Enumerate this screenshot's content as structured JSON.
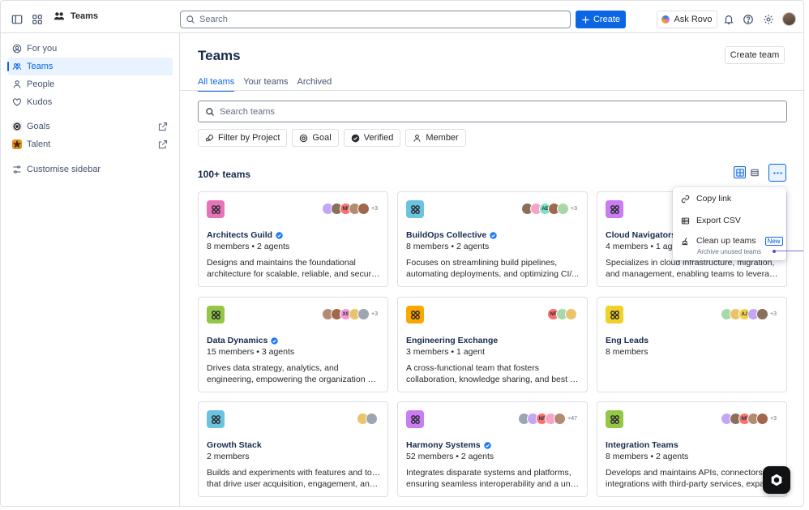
{
  "topnav": {
    "app_name": "Teams",
    "search_placeholder": "Search",
    "create_label": "Create",
    "ask_rovo_label": "Ask Rovo"
  },
  "sidebar": {
    "items": [
      {
        "label": "For you",
        "icon": "user-circle-icon"
      },
      {
        "label": "Teams",
        "icon": "teams-icon",
        "active": true
      },
      {
        "label": "People",
        "icon": "person-icon"
      },
      {
        "label": "Kudos",
        "icon": "heart-icon"
      }
    ],
    "apps": [
      {
        "label": "Goals",
        "icon": "goals-icon"
      },
      {
        "label": "Talent",
        "icon": "talent-icon"
      }
    ],
    "customise_label": "Customise sidebar"
  },
  "main": {
    "title": "Teams",
    "create_team_label": "Create team",
    "tabs": [
      "All teams",
      "Your teams",
      "Archived"
    ],
    "search_placeholder": "Search teams",
    "filters": [
      "Filter by Project",
      "Goal",
      "Verified",
      "Member"
    ],
    "count_label": "100+ teams"
  },
  "menu": {
    "items": [
      "Copy link",
      "Export CSV",
      "Clean up teams"
    ],
    "badge": "New",
    "subtext": "Archive unused teams"
  },
  "cards": [
    {
      "name": "Architects Guild",
      "verified": true,
      "meta": "8 members • 2 agents",
      "desc": [
        "Designs and maintains the foundational",
        "architecture for scalable, reliable, and secure..."
      ],
      "color": "#e774bb",
      "avatars": [
        "",
        "",
        "NF",
        "",
        ""
      ],
      "more": "+3"
    },
    {
      "name": "BuildOps Collective",
      "verified": true,
      "meta": "8 members • 2 agents",
      "desc": [
        "Focuses on streamlining build pipelines,",
        "automating deployments, and optimizing CI/..."
      ],
      "color": "#6cc3e0",
      "avatars": [
        "",
        "",
        "AE",
        "",
        ""
      ],
      "more": "+3"
    },
    {
      "name": "Cloud Navigators",
      "verified": true,
      "meta": "4 members • 1 agent",
      "desc": [
        "Specializes in cloud infrastructure, migration,",
        "and management, enabling teams to leverage..."
      ],
      "color": "#c97cf4",
      "avatars": [],
      "more": ""
    },
    {
      "name": "Data Dynamics",
      "verified": true,
      "meta": "15 members • 3 agents",
      "desc": [
        "Drives data strategy, analytics, and",
        "engineering, empowering the organization with..."
      ],
      "color": "#94c748",
      "avatars": [
        "",
        "",
        "XS",
        "",
        ""
      ],
      "more": "+3"
    },
    {
      "name": "Engineering Exchange",
      "verified": false,
      "meta": "3 members • 1 agent",
      "desc": [
        "A cross-functional team that fosters",
        "collaboration, knowledge sharing, and best p..."
      ],
      "color": "#fca700",
      "avatars": [
        "NF",
        "",
        ""
      ],
      "more": ""
    },
    {
      "name": "Eng Leads",
      "verified": false,
      "meta": "8 members",
      "desc": [],
      "color": "#eed12b",
      "avatars": [
        "",
        "",
        "AJ",
        "",
        ""
      ],
      "more": "+3"
    },
    {
      "name": "Growth Stack",
      "verified": false,
      "meta": "2 members",
      "desc": [
        "Builds and experiments with features and tools",
        "that drive user acquisition, engagement, and..."
      ],
      "color": "#6cc3e0",
      "avatars": [
        "",
        ""
      ],
      "more": ""
    },
    {
      "name": "Harmony Systems",
      "verified": true,
      "meta": "52 members • 2 agents",
      "desc": [
        "Integrates disparate systems and platforms,",
        "ensuring seamless interoperability and a unifi..."
      ],
      "color": "#c97cf4",
      "avatars": [
        "",
        "",
        "NF",
        "",
        ""
      ],
      "more": "+47"
    },
    {
      "name": "Integration Teams",
      "verified": false,
      "meta": "8 members • 2 agents",
      "desc": [
        "Develops and maintains APIs, connectors, and",
        "integrations with third-party services, expa..."
      ],
      "color": "#94c748",
      "avatars": [
        "",
        "",
        "NF",
        "",
        ""
      ],
      "more": "+3"
    }
  ]
}
